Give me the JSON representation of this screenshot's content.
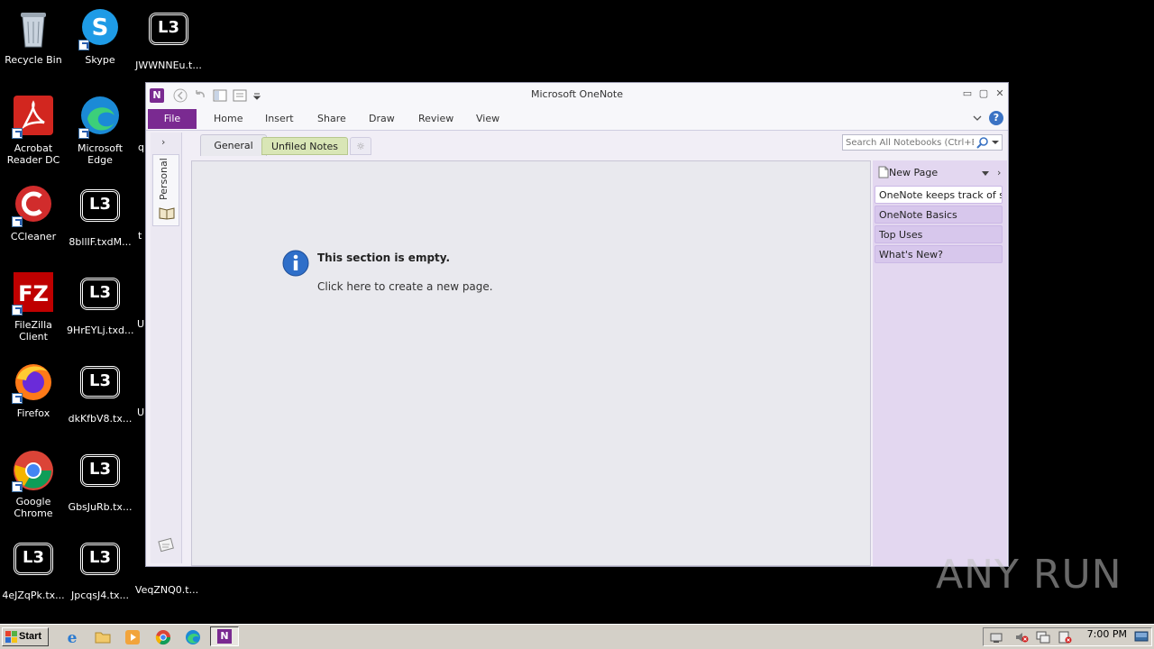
{
  "desktop": {
    "icons": [
      {
        "label": "Recycle Bin",
        "icon": "recycle-bin-icon"
      },
      {
        "label": "Skype",
        "icon": "skype-icon"
      },
      {
        "label": "JWWNNEu.t...",
        "icon": "lb3-file-icon"
      },
      {
        "label": "Acrobat Reader DC",
        "icon": "acrobat-icon"
      },
      {
        "label": "Microsoft Edge",
        "icon": "edge-icon"
      },
      {
        "label": "CCleaner",
        "icon": "ccleaner-icon"
      },
      {
        "label": "8bllIF.txdM...",
        "icon": "lb3-file-icon"
      },
      {
        "label": "FileZilla Client",
        "icon": "filezilla-icon"
      },
      {
        "label": "9HrEYLj.txd...",
        "icon": "lb3-file-icon"
      },
      {
        "label": "Firefox",
        "icon": "firefox-icon"
      },
      {
        "label": "dkKfbV8.tx...",
        "icon": "lb3-file-icon"
      },
      {
        "label": "Google Chrome",
        "icon": "chrome-icon"
      },
      {
        "label": "GbsJuRb.tx...",
        "icon": "lb3-file-icon"
      },
      {
        "label": "4eJZqPk.tx...",
        "icon": "lb3-file-icon"
      },
      {
        "label": "JpcqsJ4.tx...",
        "icon": "lb3-file-icon"
      },
      {
        "label": "VeqZNQ0.t...",
        "icon": "lb3-file-icon"
      }
    ],
    "partial_labels": [
      "q",
      "t",
      "U",
      "U"
    ]
  },
  "window": {
    "title": "Microsoft OneNote",
    "ribbon_tabs": [
      "File",
      "Home",
      "Insert",
      "Share",
      "Draw",
      "Review",
      "View"
    ],
    "notebook_name": "Personal",
    "section_tabs": [
      "General",
      "Unfiled Notes"
    ],
    "search_placeholder": "Search All Notebooks (Ctrl+E)",
    "empty_title": "This section is empty.",
    "empty_link": "Click here to create a new page.",
    "new_page_label": "New Page",
    "pages": [
      "OneNote keeps track of st",
      "OneNote Basics",
      "Top Uses",
      "What's New?"
    ]
  },
  "taskbar": {
    "start_label": "Start",
    "clock": "7:00 PM"
  },
  "watermark": "ANY RUN",
  "colors": {
    "onenote_purple": "#7a2a91",
    "page_pane": "#e3d7f0",
    "desktop_bg": "#000000",
    "taskbar_bg": "#d4d0c8"
  }
}
